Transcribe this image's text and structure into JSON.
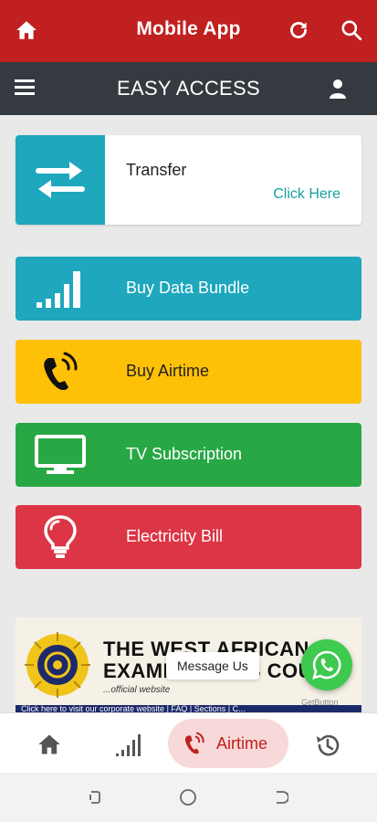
{
  "header": {
    "title": "Mobile App",
    "icons": [
      "home-icon",
      "refresh-icon",
      "search-icon"
    ]
  },
  "subheader": {
    "title": "EASY ACCESS",
    "icons": [
      "menu-icon",
      "user-icon"
    ]
  },
  "transfer_card": {
    "label": "Transfer",
    "link": "Click Here",
    "color": "#1ea7bd"
  },
  "services": [
    {
      "label": "Buy Data Bundle",
      "icon": "signal-bars-icon",
      "color": "#1ea7bd"
    },
    {
      "label": "Buy Airtime",
      "icon": "phone-ringing-icon",
      "color": "#ffc107"
    },
    {
      "label": "TV Subscription",
      "icon": "tv-icon",
      "color": "#28a745"
    },
    {
      "label": "Electricity Bill",
      "icon": "lightbulb-icon",
      "color": "#dc3545"
    }
  ],
  "banner": {
    "line1": "THE WEST AFRICAN",
    "line2": "EXAMINATIONS COUNC",
    "line3": "...official website",
    "strip": "Click here to visit our corporate website | FAQ | Sections | C..."
  },
  "chat": {
    "bubble": "Message Us",
    "powered": "GetButton"
  },
  "bottom_nav": {
    "items": [
      {
        "icon": "home-icon"
      },
      {
        "icon": "signal-bars-icon"
      },
      {
        "icon": "phone-ringing-icon",
        "label": "Airtime",
        "active": true
      },
      {
        "icon": "history-icon"
      }
    ],
    "active_color": "#c0201f"
  },
  "colors": {
    "brand_red": "#c0201f",
    "dark_bar": "#343a40"
  }
}
